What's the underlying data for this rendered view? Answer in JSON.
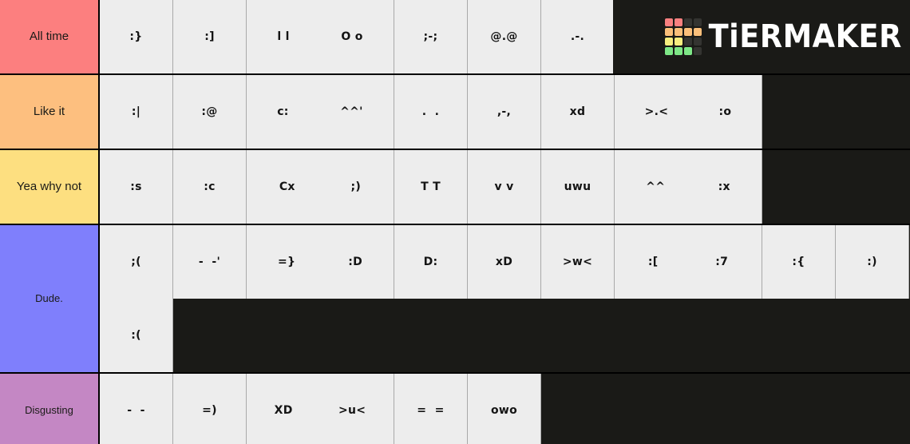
{
  "brand": {
    "name": "TiERMAKER",
    "logo_name": "tiermaker-logo",
    "logo_colors": [
      "#F98080",
      "#F98080",
      "#343431",
      "#343431",
      "#FBBF7A",
      "#FBBF7A",
      "#FBBF7A",
      "#FBBF7A",
      "#F7EE7F",
      "#F7EE7F",
      "#343431",
      "#343431",
      "#7EE787",
      "#7EE787",
      "#7EE787",
      "#343431"
    ]
  },
  "canvas": {
    "background": "#1A1A17",
    "cell_background": "#EDEDED",
    "cell_border": "#A9A9A9",
    "row_border": "#000000"
  },
  "tiers": [
    {
      "label": "All time",
      "color": "#FC7F7F",
      "label_size": "normal",
      "cells": [
        {
          "items": [
            ":}"
          ]
        },
        {
          "items": [
            ":]"
          ]
        },
        {
          "items": [
            "l l",
            "O o"
          ]
        },
        {
          "items": [
            ";-;"
          ]
        },
        {
          "items": [
            "@.@"
          ]
        },
        {
          "items": [
            ".-."
          ]
        }
      ]
    },
    {
      "label": "Like it",
      "color": "#FDBF7F",
      "label_size": "normal",
      "cells": [
        {
          "items": [
            ":|"
          ]
        },
        {
          "items": [
            ":@"
          ]
        },
        {
          "items": [
            "c:",
            "^^'"
          ]
        },
        {
          "items": [
            ".  ."
          ]
        },
        {
          "items": [
            ",-,"
          ]
        },
        {
          "items": [
            "xd"
          ]
        },
        {
          "items": [
            ">.<",
            ":o"
          ]
        }
      ]
    },
    {
      "label": "Yea why not",
      "color": "#FDDF80",
      "label_size": "normal",
      "cells": [
        {
          "items": [
            ":s"
          ]
        },
        {
          "items": [
            ":c"
          ]
        },
        {
          "items": [
            "Cx",
            ";)"
          ]
        },
        {
          "items": [
            "T T"
          ]
        },
        {
          "items": [
            "v v"
          ]
        },
        {
          "items": [
            "uwu"
          ]
        },
        {
          "items": [
            "^^",
            ":x"
          ]
        }
      ]
    },
    {
      "label": "Dude.",
      "color": "#7F7FFC",
      "label_size": "small",
      "cells": [
        {
          "items": [
            ";("
          ]
        },
        {
          "items": [
            "-  -'"
          ]
        },
        {
          "items": [
            "=}",
            ":D"
          ]
        },
        {
          "items": [
            "D:"
          ]
        },
        {
          "items": [
            "xD"
          ]
        },
        {
          "items": [
            ">w<"
          ]
        },
        {
          "items": [
            ":[",
            ":7"
          ]
        },
        {
          "items": [
            ":{"
          ]
        },
        {
          "items": [
            ":)"
          ]
        },
        {
          "items": [
            ":("
          ]
        }
      ]
    },
    {
      "label": "Disgusting",
      "color": "#C487C4",
      "label_size": "small",
      "cells": [
        {
          "items": [
            "-  -"
          ]
        },
        {
          "items": [
            "=)"
          ]
        },
        {
          "items": [
            "XD",
            ">u<"
          ]
        },
        {
          "items": [
            "=  ="
          ]
        },
        {
          "items": [
            "owo"
          ]
        }
      ]
    }
  ]
}
